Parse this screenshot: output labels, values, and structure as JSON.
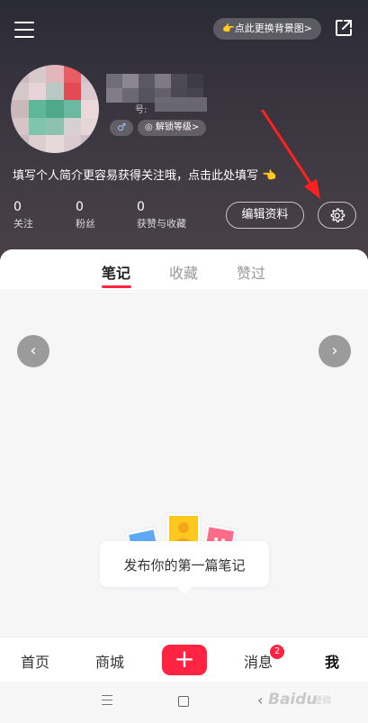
{
  "header": {
    "change_bg_label": "👉点此更换背景图>",
    "id_prefix": "号:",
    "level_label": "解锁等级>",
    "gender_symbol": "♂",
    "bio_prompt": "填写个人简介更容易获得关注哦，点击此处填写 👈",
    "stats": {
      "following": {
        "count": "0",
        "label": "关注"
      },
      "fans": {
        "count": "0",
        "label": "粉丝"
      },
      "likes": {
        "count": "0",
        "label": "获赞与收藏"
      }
    },
    "edit_profile_label": "编辑资料"
  },
  "tabs": [
    {
      "label": "笔记",
      "active": true
    },
    {
      "label": "收藏",
      "active": false
    },
    {
      "label": "赞过",
      "active": false
    }
  ],
  "feed": {
    "nav_left_symbol": "‹",
    "nav_right_symbol": "›",
    "empty_text": "发布你的第一篇笔记"
  },
  "bottom_nav": {
    "home": "首页",
    "mall": "商城",
    "add_symbol": "+",
    "messages": "消息",
    "messages_badge": "2",
    "me": "我"
  },
  "system_bar": {
    "back_symbol": "‹",
    "watermark": "Baidu",
    "watermark_sub": "经验"
  },
  "colors": {
    "accent": "#ff2442",
    "header_bg": "#3a3640"
  },
  "icons": {
    "menu": "menu-icon",
    "share": "share-icon",
    "settings": "gear-icon",
    "level": "medal-icon"
  }
}
